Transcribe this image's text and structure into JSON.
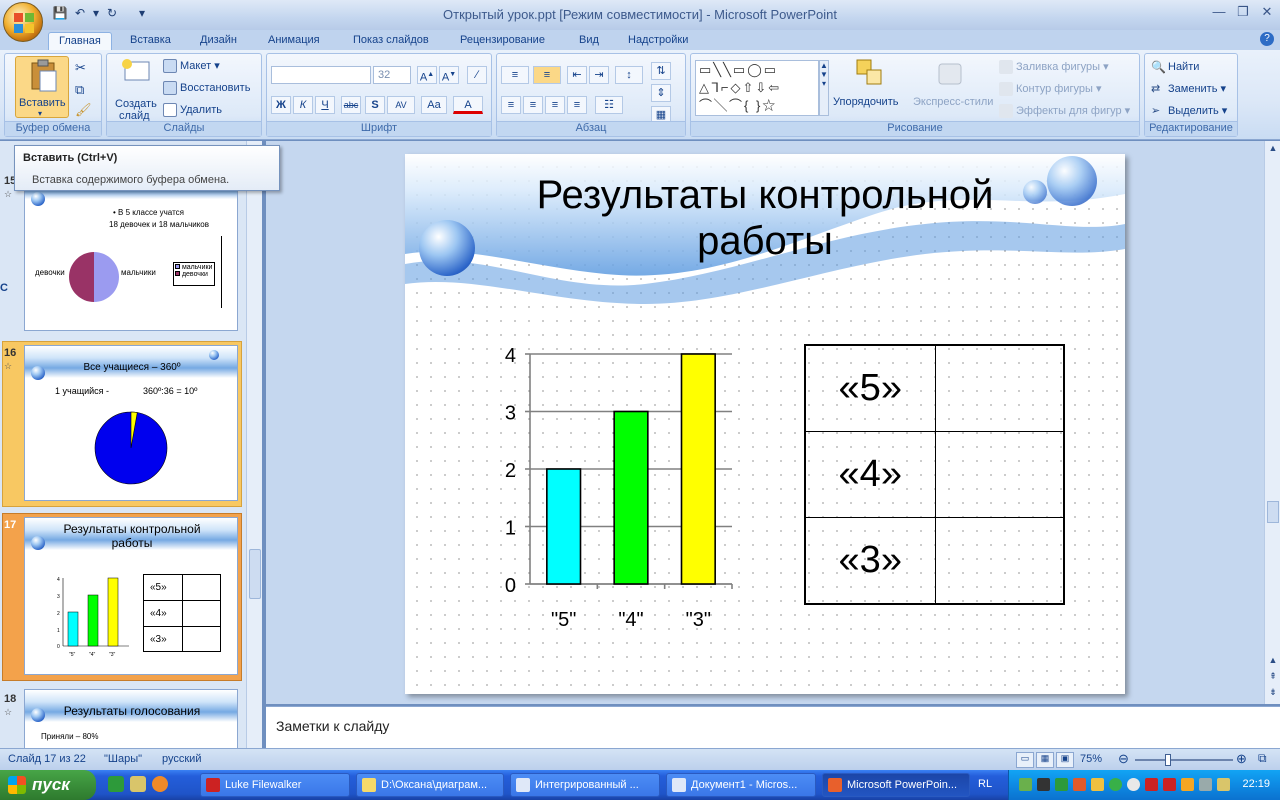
{
  "window": {
    "title": "Открытый урок.ppt [Режим совместимости] - Microsoft PowerPoint"
  },
  "tabs": [
    "Главная",
    "Вставка",
    "Дизайн",
    "Анимация",
    "Показ слайдов",
    "Рецензирование",
    "Вид",
    "Надстройки"
  ],
  "ribbon": {
    "groups": {
      "clipboard": "Буфер обмена",
      "slides": "Слайды",
      "font": "Шрифт",
      "paragraph": "Абзац",
      "drawing": "Рисование",
      "editing": "Редактирование"
    },
    "paste_label": "Вставить",
    "new_slide_label_1": "Создать",
    "new_slide_label_2": "слайд",
    "layout_label": "Макет",
    "reset_label": "Восстановить",
    "delete_label": "Удалить",
    "font_name": "",
    "font_size": "32",
    "arrange_label": "Упорядочить",
    "quick_styles_label": "Экспресс-стили",
    "shape_fill_label": "Заливка фигуры",
    "shape_outline_label": "Контур фигуры",
    "shape_effects_label": "Эффекты для фигур",
    "find_label": "Найти",
    "replace_label": "Заменить",
    "select_label": "Выделить"
  },
  "tooltip": {
    "title": "Вставить (Ctrl+V)",
    "description": "Вставка содержимого буфера обмена."
  },
  "thumbnails": {
    "s15": {
      "num": "15",
      "bullet": "•  В 5 классе учатся",
      "line2": "18 девочек  и 18 мальчиков",
      "label_girls": "девочки",
      "label_boys": "мальчики",
      "legend_boys": "мальчики",
      "legend_girls": "девочки"
    },
    "s16": {
      "num": "16",
      "title": "Все учащиеся – 360º",
      "left_text": "1 учащийся -",
      "right_text": "360º:36 = 10º"
    },
    "s17": {
      "num": "17",
      "title": "Результаты контрольной работы",
      "cells": [
        "«5»",
        "«4»",
        "«3»"
      ],
      "ticks": [
        "4",
        "3",
        "2",
        "1",
        "0"
      ],
      "xlabels": [
        "\"5\"",
        "\"4\"",
        "\"3\""
      ]
    },
    "s18": {
      "num": "18",
      "title": "Результаты голосования",
      "line1": "Приняли – 80%"
    }
  },
  "slide": {
    "title_line1": "Результаты контрольной",
    "title_line2": "работы",
    "table_labels": [
      "«5»",
      "«4»",
      "«3»"
    ]
  },
  "chart_data": {
    "type": "bar",
    "categories": [
      "\"5\"",
      "\"4\"",
      "\"3\""
    ],
    "values": [
      2,
      3,
      4
    ],
    "colors": [
      "#00ffff",
      "#00ff00",
      "#ffff00"
    ],
    "yticks": [
      "0",
      "1",
      "2",
      "3",
      "4"
    ],
    "ylim": [
      0,
      4
    ],
    "grid": true,
    "title": "",
    "xlabel": "",
    "ylabel": ""
  },
  "notes": {
    "placeholder": "Заметки к слайду"
  },
  "status": {
    "slide_counter": "Слайд 17 из 22",
    "theme": "\"Шары\"",
    "language": "русский",
    "zoom": "75%"
  },
  "taskbar": {
    "start": "пуск",
    "tasks": [
      "Luke Filewalker",
      "D:\\Оксана\\диаграм...",
      "Интегрированный ...",
      "Документ1 - Micros...",
      "Microsoft PowerPoin..."
    ],
    "lang": "RL",
    "clock": "22:19"
  },
  "colors": {
    "accent": "#15428b",
    "ribbon_bg": "#dbe7f7",
    "selected_thumb": "#f3a24b"
  }
}
